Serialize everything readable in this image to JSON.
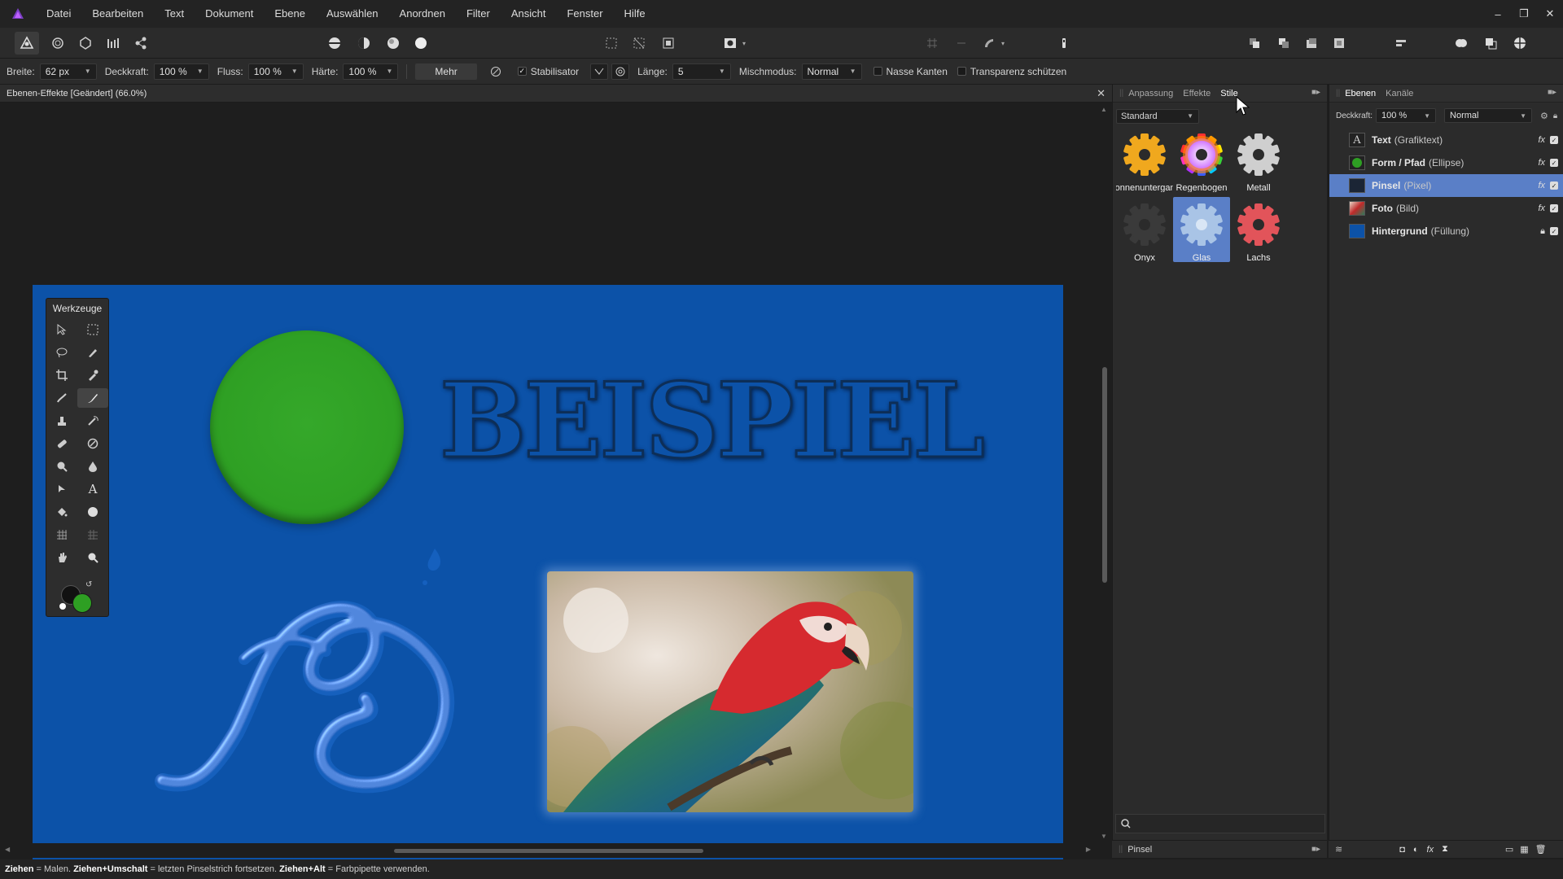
{
  "menu": [
    "Datei",
    "Bearbeiten",
    "Text",
    "Dokument",
    "Ebene",
    "Auswählen",
    "Anordnen",
    "Filter",
    "Ansicht",
    "Fenster",
    "Hilfe"
  ],
  "context": {
    "width_label": "Breite:",
    "width_value": "62 px",
    "opacity_label": "Deckkraft:",
    "opacity_value": "100 %",
    "flow_label": "Fluss:",
    "flow_value": "100 %",
    "hardness_label": "Härte:",
    "hardness_value": "100 %",
    "more_label": "Mehr",
    "stabilizer_label": "Stabilisator",
    "length_label": "Länge:",
    "length_value": "5",
    "blend_label": "Mischmodus:",
    "blend_value": "Normal",
    "wet_edges_label": "Nasse Kanten",
    "protect_alpha_label": "Transparenz schützen"
  },
  "document": {
    "tab_title": "Ebenen-Effekte [Geändert] (66.0%)",
    "headline": "BEISPIEL"
  },
  "tools_panel": {
    "title": "Werkzeuge"
  },
  "styles_panel": {
    "tabs": [
      "Anpassung",
      "Effekte",
      "Stile"
    ],
    "active_tab": "Stile",
    "category": "Standard",
    "items": [
      {
        "label": "Sonnenuntergang",
        "color": "#f0a81e"
      },
      {
        "label": "Regenbogen",
        "color": "rainbow"
      },
      {
        "label": "Metall",
        "color": "#cfcfcf"
      },
      {
        "label": "Onyx",
        "color": "#3a3a3a"
      },
      {
        "label": "Glas",
        "color": "#a9c4e6"
      },
      {
        "label": "Lachs",
        "color": "#e2545a"
      }
    ],
    "selected": "Glas",
    "bottom_label": "Pinsel"
  },
  "layers_panel": {
    "tabs": [
      "Ebenen",
      "Kanäle"
    ],
    "active_tab": "Ebenen",
    "opacity_label": "Deckkraft:",
    "opacity_value": "100 %",
    "blend_value": "Normal",
    "layers": [
      {
        "name": "Text",
        "type": "(Grafiktext)",
        "selected": false
      },
      {
        "name": "Form / Pfad",
        "type": "(Ellipse)",
        "selected": false
      },
      {
        "name": "Pinsel",
        "type": "(Pixel)",
        "selected": true
      },
      {
        "name": "Foto",
        "type": "(Bild)",
        "selected": false
      },
      {
        "name": "Hintergrund",
        "type": "(Füllung)",
        "selected": false
      }
    ]
  },
  "status": {
    "k1": "Ziehen",
    "t1": " = Malen. ",
    "k2": "Ziehen+Umschalt",
    "t2": " = letzten Pinselstrich fortsetzen. ",
    "k3": "Ziehen+Alt",
    "t3": " = Farbpipette verwenden."
  },
  "colors": {
    "canvas_bg": "#0c52a8",
    "circle": "#2e9f23",
    "selection": "#5a7fc7",
    "primary": "#111111",
    "secondary": "#2e9f23"
  }
}
